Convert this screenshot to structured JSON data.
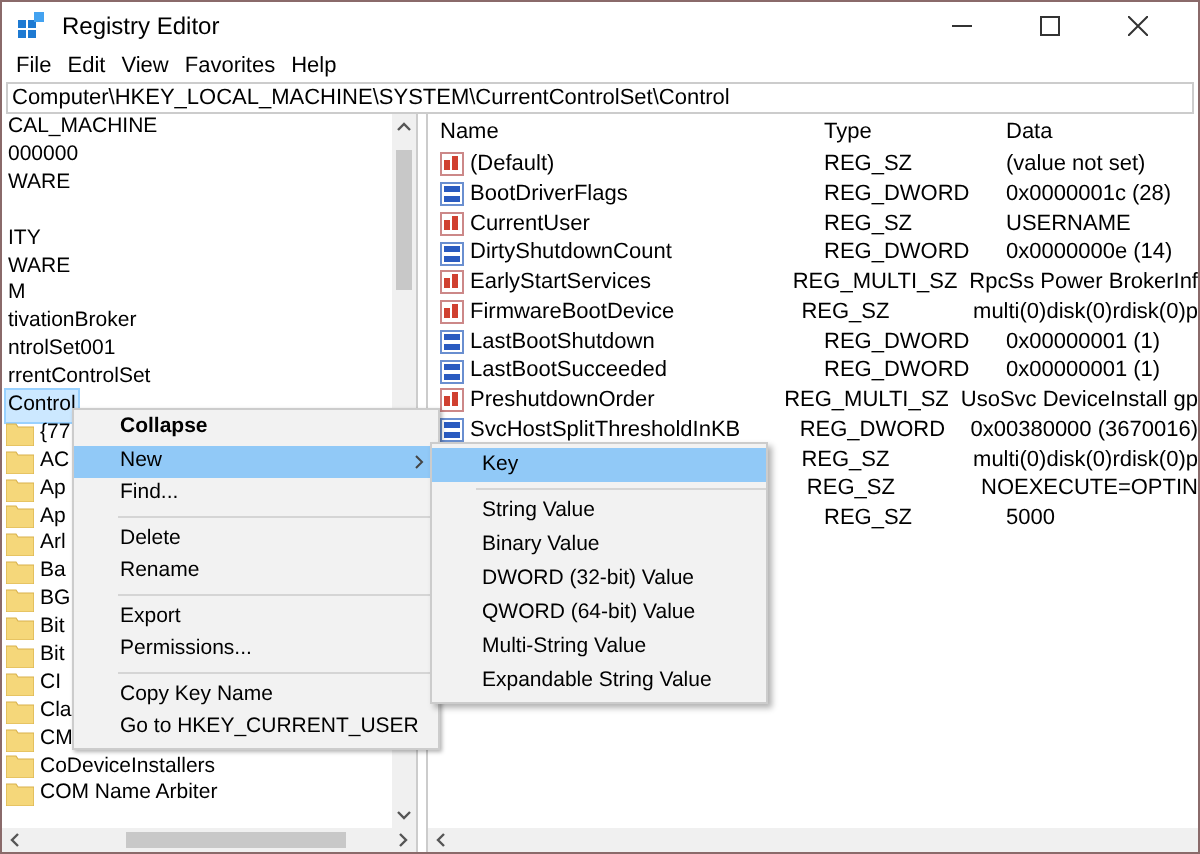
{
  "window": {
    "title": "Registry Editor"
  },
  "menu": [
    "File",
    "Edit",
    "View",
    "Favorites",
    "Help"
  ],
  "address": "Computer\\HKEY_LOCAL_MACHINE\\SYSTEM\\CurrentControlSet\\Control",
  "tree": [
    {
      "label": "CAL_MACHINE",
      "kind": "plain",
      "selected": false
    },
    {
      "label": "000000",
      "kind": "plain",
      "selected": false
    },
    {
      "label": "WARE",
      "kind": "plain",
      "selected": false
    },
    {
      "kind": "blank"
    },
    {
      "label": "ITY",
      "kind": "plain",
      "selected": false
    },
    {
      "label": "WARE",
      "kind": "plain",
      "selected": false
    },
    {
      "label": "M",
      "kind": "plain",
      "selected": false
    },
    {
      "label": "tivationBroker",
      "kind": "plain",
      "selected": false
    },
    {
      "label": "ntrolSet001",
      "kind": "plain",
      "selected": false
    },
    {
      "label": "rrentControlSet",
      "kind": "plain",
      "selected": false
    },
    {
      "label": "Control",
      "kind": "plain",
      "selected": true
    },
    {
      "label": "{77",
      "kind": "folder",
      "selected": false
    },
    {
      "label": "AC",
      "kind": "folder",
      "selected": false
    },
    {
      "label": "Ap",
      "kind": "folder",
      "selected": false
    },
    {
      "label": "Ap",
      "kind": "folder",
      "selected": false
    },
    {
      "label": "Arl",
      "kind": "folder",
      "selected": false
    },
    {
      "label": "Ba",
      "kind": "folder",
      "selected": false
    },
    {
      "label": "BG",
      "kind": "folder",
      "selected": false
    },
    {
      "label": "Bit",
      "kind": "folder",
      "selected": false
    },
    {
      "label": "Bit",
      "kind": "folder",
      "selected": false
    },
    {
      "label": "CI",
      "kind": "folder",
      "selected": false
    },
    {
      "label": "Cla",
      "kind": "folder",
      "selected": false
    },
    {
      "label": "CM",
      "kind": "folder",
      "selected": false
    },
    {
      "label": "CoDeviceInstallers",
      "kind": "folder",
      "selected": false
    },
    {
      "label": "COM Name Arbiter",
      "kind": "folder",
      "selected": false
    }
  ],
  "values": {
    "columns": [
      "Name",
      "Type",
      "Data"
    ],
    "rows": [
      {
        "name": "(Default)",
        "kind": "string",
        "type": "REG_SZ",
        "data": "(value not set)"
      },
      {
        "name": "BootDriverFlags",
        "kind": "binary",
        "type": "REG_DWORD",
        "data": "0x0000001c (28)"
      },
      {
        "name": "CurrentUser",
        "kind": "string",
        "type": "REG_SZ",
        "data": "USERNAME"
      },
      {
        "name": "DirtyShutdownCount",
        "kind": "binary",
        "type": "REG_DWORD",
        "data": "0x0000000e (14)"
      },
      {
        "name": "EarlyStartServices",
        "kind": "string",
        "type": "REG_MULTI_SZ",
        "data": "RpcSs Power BrokerInf"
      },
      {
        "name": "FirmwareBootDevice",
        "kind": "string",
        "type": "REG_SZ",
        "data": "multi(0)disk(0)rdisk(0)p"
      },
      {
        "name": "LastBootShutdown",
        "kind": "binary",
        "type": "REG_DWORD",
        "data": "0x00000001 (1)"
      },
      {
        "name": "LastBootSucceeded",
        "kind": "binary",
        "type": "REG_DWORD",
        "data": "0x00000001 (1)"
      },
      {
        "name": "PreshutdownOrder",
        "kind": "string",
        "type": "REG_MULTI_SZ",
        "data": "UsoSvc DeviceInstall gp"
      },
      {
        "name": "SvcHostSplitThresholdInKB",
        "kind": "binary",
        "type": "REG_DWORD",
        "data": "0x00380000 (3670016)"
      },
      {
        "type": "REG_SZ",
        "data": "multi(0)disk(0)rdisk(0)p"
      },
      {
        "type": "REG_SZ",
        "data": "NOEXECUTE=OPTIN"
      },
      {
        "type": "REG_SZ",
        "data": "5000"
      }
    ]
  },
  "context_menu": [
    {
      "kind": "item",
      "label": "Collapse",
      "bold": true,
      "submenu": false,
      "selected": false
    },
    {
      "kind": "item",
      "label": "New",
      "bold": false,
      "submenu": true,
      "selected": true
    },
    {
      "kind": "item",
      "label": "Find...",
      "bold": false,
      "submenu": false,
      "selected": false
    },
    {
      "kind": "separator"
    },
    {
      "kind": "item",
      "label": "Delete",
      "bold": false,
      "submenu": false,
      "selected": false
    },
    {
      "kind": "item",
      "label": "Rename",
      "bold": false,
      "submenu": false,
      "selected": false
    },
    {
      "kind": "separator"
    },
    {
      "kind": "item",
      "label": "Export",
      "bold": false,
      "submenu": false,
      "selected": false
    },
    {
      "kind": "item",
      "label": "Permissions...",
      "bold": false,
      "submenu": false,
      "selected": false
    },
    {
      "kind": "separator"
    },
    {
      "kind": "item",
      "label": "Copy Key Name",
      "bold": false,
      "submenu": false,
      "selected": false
    },
    {
      "kind": "item",
      "label": "Go to HKEY_CURRENT_USER",
      "bold": false,
      "submenu": false,
      "selected": false
    }
  ],
  "submenu": [
    {
      "kind": "item",
      "label": "Key",
      "selected": true
    },
    {
      "kind": "separator"
    },
    {
      "kind": "item",
      "label": "String Value",
      "selected": false
    },
    {
      "kind": "item",
      "label": "Binary Value",
      "selected": false
    },
    {
      "kind": "item",
      "label": "DWORD (32-bit) Value",
      "selected": false
    },
    {
      "kind": "item",
      "label": "QWORD (64-bit) Value",
      "selected": false
    },
    {
      "kind": "item",
      "label": "Multi-String Value",
      "selected": false
    },
    {
      "kind": "item",
      "label": "Expandable String Value",
      "selected": false
    }
  ]
}
